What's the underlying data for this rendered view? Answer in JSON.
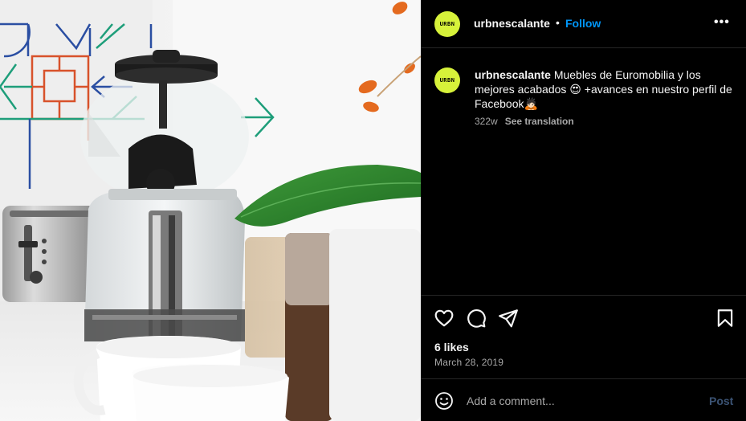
{
  "post": {
    "avatar_text": "URBN",
    "username": "urbnescalante",
    "separator": "•",
    "follow_label": "Follow",
    "more_label": "•••"
  },
  "caption": {
    "username": "urbnescalante",
    "text": " Muebles de Euromobilia y los mejores acabados 😍 +avances en nuestro perfil de Facebook🙇🏻",
    "time": "322w",
    "translate_label": "See translation"
  },
  "actions": {
    "like_icon": "heart-icon",
    "comment_icon": "comment-icon",
    "share_icon": "share-icon",
    "save_icon": "bookmark-icon"
  },
  "stats": {
    "likes": "6 likes",
    "date": "March 28, 2019"
  },
  "comment": {
    "placeholder": "Add a comment...",
    "post_label": "Post",
    "emoji_icon": "emoji-icon"
  },
  "colors": {
    "accent": "#0095f6",
    "avatar_bg": "#d7f23a",
    "muted": "#a8a8a8",
    "post_disabled": "#3b5374",
    "panel_bg": "#000000"
  }
}
